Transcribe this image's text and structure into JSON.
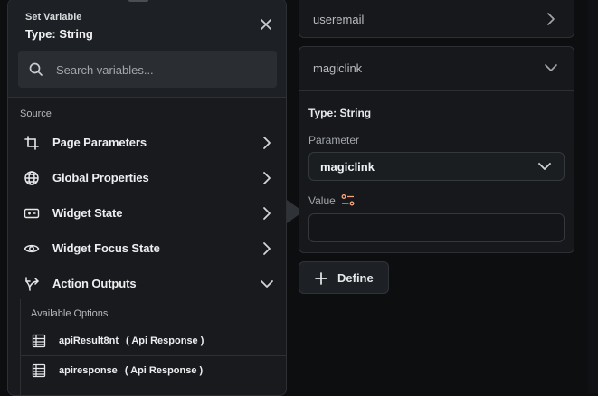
{
  "popup": {
    "title": "Set Variable",
    "type_label": "Type: String",
    "search_placeholder": "Search variables...",
    "source_label": "Source",
    "sources": [
      {
        "label": "Page Parameters",
        "icon": "page-parameters-icon",
        "expanded": false
      },
      {
        "label": "Global Properties",
        "icon": "globe-icon",
        "expanded": false
      },
      {
        "label": "Widget State",
        "icon": "widget-state-icon",
        "expanded": false
      },
      {
        "label": "Widget Focus State",
        "icon": "eye-icon",
        "expanded": false
      },
      {
        "label": "Action Outputs",
        "icon": "action-outputs-icon",
        "expanded": true
      }
    ],
    "available_label": "Available Options",
    "options": [
      {
        "name": "apiResult8nt",
        "kind": "( Api Response )"
      },
      {
        "name": "apiresponse",
        "kind": "( Api Response )"
      }
    ]
  },
  "panel": {
    "field_one": "useremail",
    "field_two": "magiclink",
    "type_text": "Type: String",
    "parameter_label": "Parameter",
    "parameter_value": "magiclink",
    "value_label": "Value",
    "define_label": "Define"
  },
  "colors": {
    "accent": "#f5a37b",
    "background": "#0d0e10",
    "surface": "#181a1d"
  }
}
